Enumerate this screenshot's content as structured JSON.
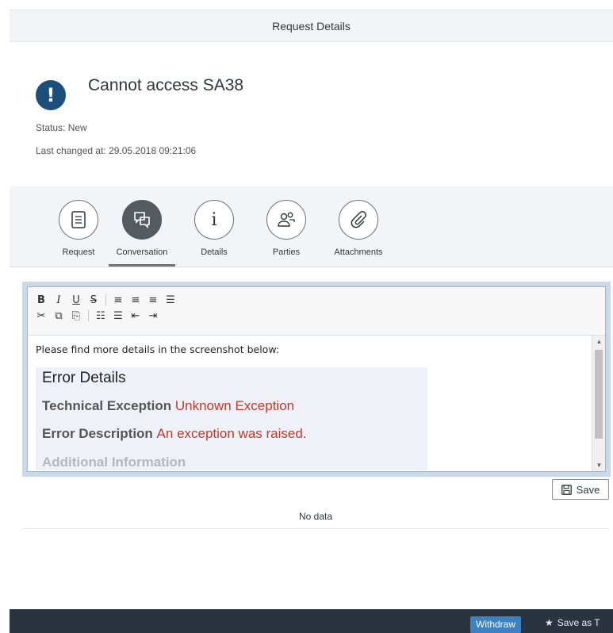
{
  "page": {
    "title": "Request Details"
  },
  "request": {
    "title": "Cannot access SA38",
    "status": "Status: New",
    "last_changed": "Last changed at: 29.05.2018 09:21:06"
  },
  "tabs": [
    {
      "label": "Request",
      "icon": "request-icon"
    },
    {
      "label": "Conversation",
      "icon": "conversation-icon",
      "active": true
    },
    {
      "label": "Details",
      "icon": "info-icon"
    },
    {
      "label": "Parties",
      "icon": "parties-icon"
    },
    {
      "label": "Attachments",
      "icon": "paperclip-icon"
    }
  ],
  "editor": {
    "toolbar_row1": [
      "B",
      "I",
      "U",
      "S",
      "align-left",
      "align-center",
      "align-right",
      "justify"
    ],
    "toolbar_row2": [
      "cut",
      "copy",
      "paste",
      "bullet-list",
      "numbered-list",
      "outdent",
      "indent"
    ],
    "intro": "Please find more details in the screenshot below:",
    "screenshot": {
      "heading": "Error Details",
      "tech_label": "Technical Exception",
      "tech_value": "Unknown Exception",
      "desc_label": "Error Description",
      "desc_value": "An exception was raised.",
      "additional": "Additional Information"
    }
  },
  "save_label": "Save",
  "no_data": "No data",
  "footer": {
    "withdraw": "Withdraw",
    "save_as": "Save as T"
  },
  "colors": {
    "accent": "#3b82c4",
    "alert": "#1b4f7a",
    "error_text": "#c0392b"
  }
}
